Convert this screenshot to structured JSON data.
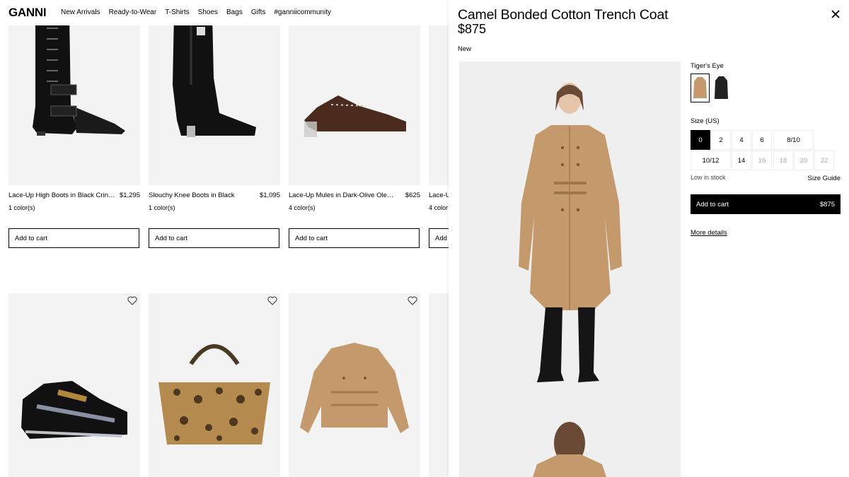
{
  "header": {
    "logo": "GANNI",
    "nav": [
      "New Arrivals",
      "Ready-to-Wear",
      "T-Shirts",
      "Shoes",
      "Bags",
      "Gifts",
      "#ganniicommunity"
    ]
  },
  "products": [
    {
      "name": "Lace-Up High Boots in Black Crinkled",
      "price": "$1,295",
      "colors": "1 color(s)",
      "cart": "Add to cart"
    },
    {
      "name": "Slouchy Knee Boots in Black",
      "price": "$1,095",
      "colors": "1 color(s)",
      "cart": "Add to cart"
    },
    {
      "name": "Lace-Up Mules in Dark-Olive Oleatex",
      "price": "$625",
      "colors": "4 color(s)",
      "cart": "Add to cart"
    },
    {
      "name": "Lace-U",
      "price": "",
      "colors": "4 color",
      "cart": "Add t"
    }
  ],
  "drawer": {
    "title": "Camel Bonded Cotton Trench Coat",
    "price": "$875",
    "badge": "New",
    "color_name": "Tiger's Eye",
    "size_label": "Size (US)",
    "sizes": [
      {
        "label": "0",
        "state": "selected"
      },
      {
        "label": "2",
        "state": "available"
      },
      {
        "label": "4",
        "state": "available"
      },
      {
        "label": "6",
        "state": "available"
      },
      {
        "label": "8/10",
        "state": "available"
      },
      {
        "label": "10/12",
        "state": "available"
      },
      {
        "label": "14",
        "state": "available"
      },
      {
        "label": "16",
        "state": "unavailable"
      },
      {
        "label": "18",
        "state": "unavailable"
      },
      {
        "label": "20",
        "state": "unavailable"
      },
      {
        "label": "22",
        "state": "unavailable"
      }
    ],
    "stock": "Low in stock",
    "size_guide": "Size Guide",
    "add_label": "Add to cart",
    "add_price": "$875",
    "more_details": "More details"
  },
  "icons": {
    "close": "close-icon",
    "wishlist": "heart-icon"
  },
  "colors": {
    "camel": "#c49a6c",
    "black": "#000000",
    "unavailable_text": "#aaaaaa"
  }
}
